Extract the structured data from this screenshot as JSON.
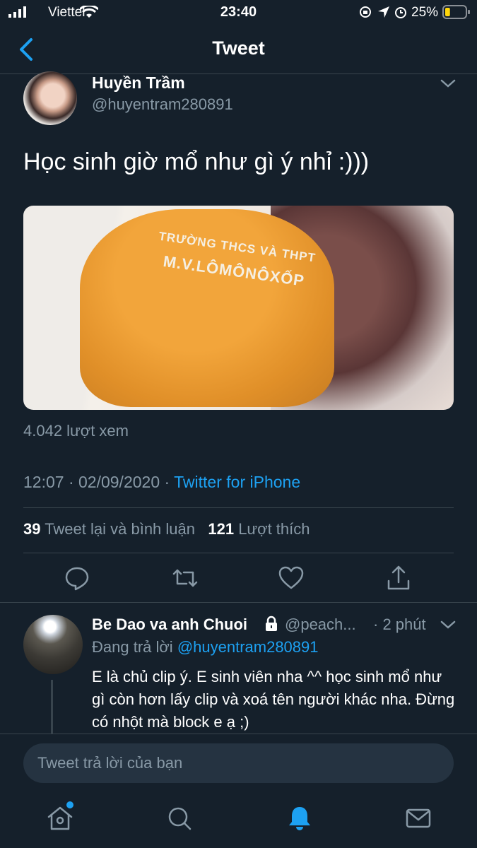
{
  "status_bar": {
    "carrier": "Viettel",
    "time": "23:40",
    "battery": "25%",
    "battery_level": 0.25
  },
  "nav": {
    "title": "Tweet"
  },
  "tweet": {
    "author_name": "Huyền Trầm",
    "author_handle": "@huyentram280891",
    "text": "Học sinh giờ mổ như gì ý nhỉ :)))",
    "media_shirt_text_1": "TRƯỜNG THCS VÀ THPT",
    "media_shirt_text_2": "M.V.LÔMÔNÔXỐP",
    "views": "4.042 lượt xem",
    "time": "12:07 · 02/09/2020 · ",
    "source": "Twitter for iPhone",
    "retweet_count": "39",
    "retweet_label": " Tweet lại và bình luận",
    "like_count": "121",
    "like_label": " Lượt thích"
  },
  "reply": {
    "author_name": "Be Dao va anh Chuoi",
    "author_handle": "@peach...",
    "time": "· 2 phút",
    "replying_label": "Đang trả lời ",
    "replying_to": "@huyentram280891",
    "text": "E là chủ clip ý. E sinh viên nha ^^ học sinh mổ như gì còn hơn lấy clip và xoá tên người khác nha. Đừng có nhột mà block e ạ ;)"
  },
  "composer": {
    "placeholder": "Tweet trả lời của bạn"
  },
  "colors": {
    "background": "#15202b",
    "accent": "#1da1f2",
    "secondary_text": "#8899a6",
    "border": "#38444d"
  },
  "icons": {
    "actions": [
      "reply-icon",
      "retweet-icon",
      "like-icon",
      "share-icon"
    ],
    "tabs": [
      "home-icon",
      "search-icon",
      "notifications-icon",
      "messages-icon"
    ]
  }
}
